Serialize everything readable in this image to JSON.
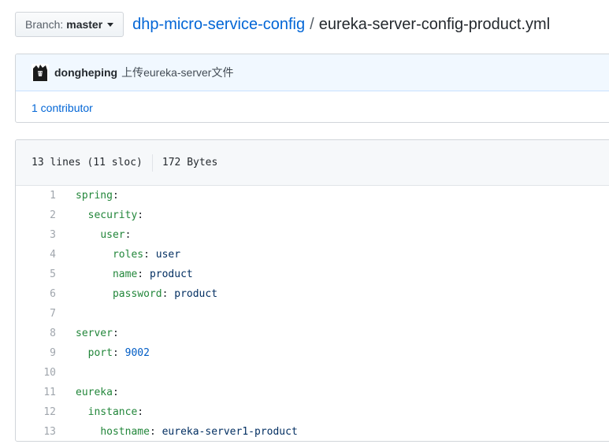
{
  "branch": {
    "label": "Branch:",
    "value": "master"
  },
  "breadcrumb": {
    "repo": "dhp-micro-service-config",
    "separator": "/",
    "file": "eureka-server-config-product.yml"
  },
  "commit": {
    "author": "dongheping",
    "message": "上传eureka-server文件"
  },
  "contributors": {
    "text": "1 contributor"
  },
  "file_info": {
    "lines": "13 lines (11 sloc)",
    "size": "172 Bytes"
  },
  "code": [
    {
      "num": "1",
      "indent": "",
      "key": "spring",
      "value": ""
    },
    {
      "num": "2",
      "indent": "  ",
      "key": "security",
      "value": ""
    },
    {
      "num": "3",
      "indent": "    ",
      "key": "user",
      "value": ""
    },
    {
      "num": "4",
      "indent": "      ",
      "key": "roles",
      "value": "user"
    },
    {
      "num": "5",
      "indent": "      ",
      "key": "name",
      "value": "product"
    },
    {
      "num": "6",
      "indent": "      ",
      "key": "password",
      "value": "product"
    },
    {
      "num": "7",
      "indent": "",
      "key": "",
      "value": ""
    },
    {
      "num": "8",
      "indent": "",
      "key": "server",
      "value": ""
    },
    {
      "num": "9",
      "indent": "  ",
      "key": "port",
      "value": "9002",
      "numeric": true
    },
    {
      "num": "10",
      "indent": "",
      "key": "",
      "value": ""
    },
    {
      "num": "11",
      "indent": "",
      "key": "eureka",
      "value": ""
    },
    {
      "num": "12",
      "indent": "  ",
      "key": "instance",
      "value": ""
    },
    {
      "num": "13",
      "indent": "    ",
      "key": "hostname",
      "value": "eureka-server1-product"
    }
  ],
  "colors": {
    "link": "#0366d6",
    "yaml_key": "#22863a",
    "yaml_number": "#005cc5",
    "yaml_string": "#032f62"
  }
}
